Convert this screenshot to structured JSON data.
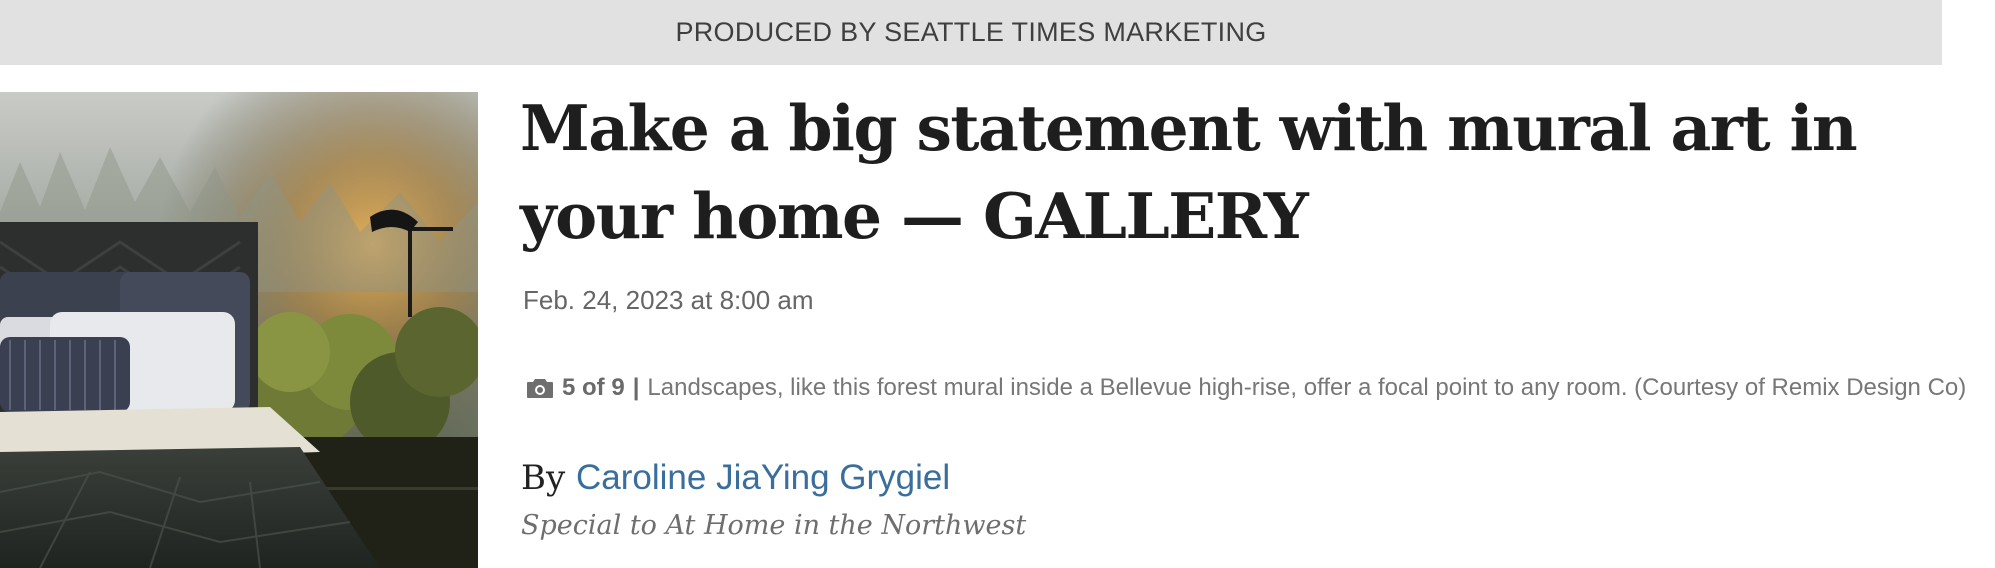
{
  "banner": {
    "text": "PRODUCED BY SEATTLE TIMES MARKETING"
  },
  "article": {
    "headline": "Make a big statement with mural art in your home — GALLERY",
    "date": "Feb. 24, 2023 at 8:00 am",
    "gallery": {
      "count": "5 of 9",
      "separator": "|",
      "caption": "Landscapes, like this forest mural inside a Bellevue high-rise, offer a focal point to any room. (Courtesy of Remix Design Co)",
      "icon": "camera-icon"
    },
    "byline": {
      "prefix": "By",
      "author": "Caroline JiaYing Grygiel",
      "source": "Special to At Home in the Northwest"
    }
  },
  "colors": {
    "banner_bg": "#e1e1e1",
    "author_link": "#3a6e9c",
    "headline": "#1e1e1e"
  }
}
